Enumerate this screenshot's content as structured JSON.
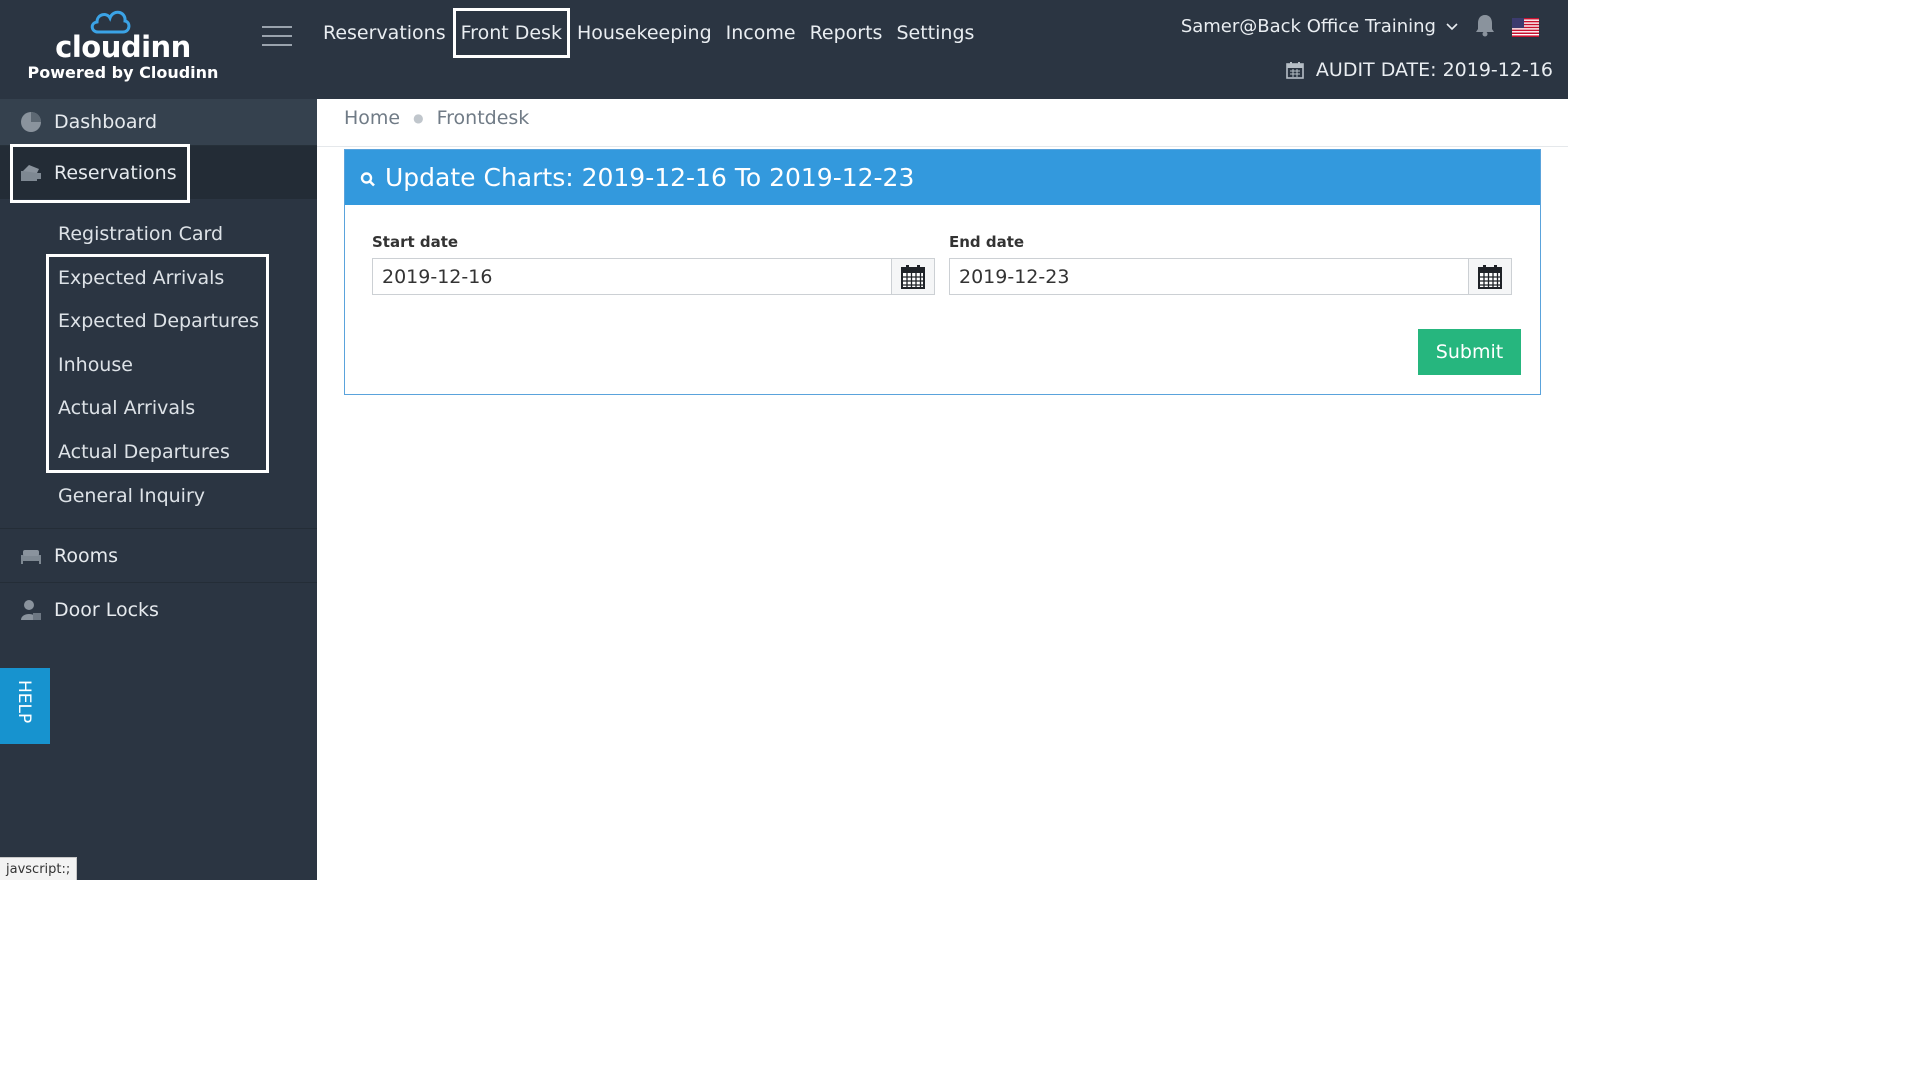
{
  "header": {
    "logo_text": "cloudinn",
    "powered_by": "Powered by Cloudinn",
    "nav": [
      "Reservations",
      "Front Desk",
      "Housekeeping",
      "Income",
      "Reports",
      "Settings"
    ],
    "user": "Samer@Back Office Training",
    "audit_date": "AUDIT DATE: 2019-12-16"
  },
  "sidebar": {
    "items": [
      {
        "label": "Dashboard",
        "icon": "pie-chart-icon"
      },
      {
        "label": "Reservations",
        "icon": "reservations-icon"
      },
      {
        "label": "Rooms",
        "icon": "bed-icon"
      },
      {
        "label": "Door Locks",
        "icon": "user-lock-icon"
      }
    ],
    "sub_items": [
      "Registration Card",
      "Expected Arrivals",
      "Expected Departures",
      "Inhouse",
      "Actual Arrivals",
      "Actual Departures",
      "General Inquiry"
    ],
    "help_label": "HELP"
  },
  "breadcrumb": {
    "home": "Home",
    "current": "Frontdesk"
  },
  "panel": {
    "title": "Update Charts: 2019-12-16 To 2019-12-23",
    "start_label": "Start date",
    "start_value": "2019-12-16",
    "end_label": "End date",
    "end_value": "2019-12-23",
    "submit_label": "Submit"
  },
  "status_bar_url": "javscript:;",
  "colors": {
    "topbar": "#2b3542",
    "panel_header": "#3399dd",
    "submit": "#26b67e",
    "help": "#1793cf"
  }
}
